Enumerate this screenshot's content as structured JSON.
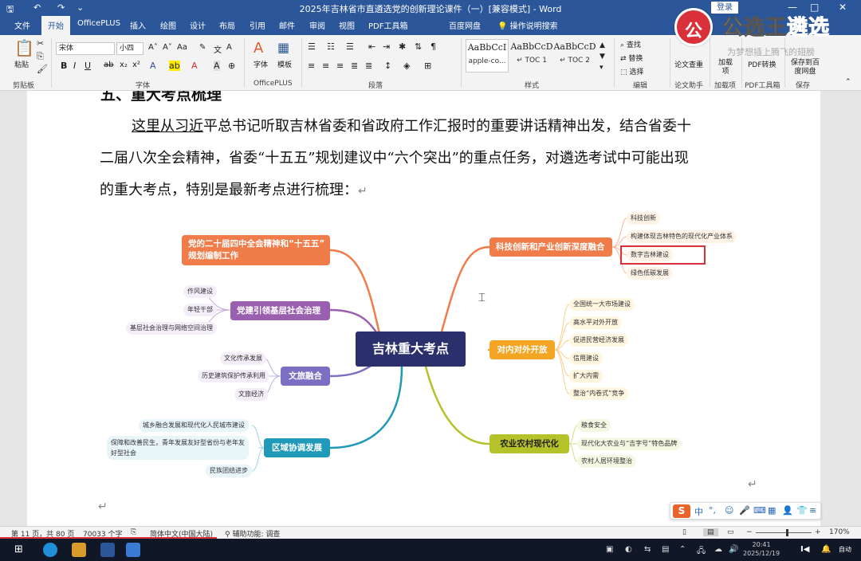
{
  "window": {
    "title": "2025年吉林省市直遴选党的创新理论课件（一）[兼容模式] - Word",
    "login_label": "登录",
    "minimize": "—",
    "maximize": "□",
    "close": "✕"
  },
  "brand": {
    "name_main": "公选王",
    "name_accent": "遴选",
    "slogan": "为梦想插上腾飞的翅膀"
  },
  "menu": {
    "items": [
      "文件",
      "开始",
      "OfficePLUS",
      "插入",
      "绘图",
      "设计",
      "布局",
      "引用",
      "邮件",
      "审阅",
      "视图",
      "PDF工具箱",
      "百度网盘"
    ],
    "active": "开始",
    "tell_me": "操作说明搜索"
  },
  "ribbon": {
    "clipboard": {
      "paste": "粘贴",
      "label": "剪贴板"
    },
    "font": {
      "name": "宋体",
      "size": "小四",
      "label": "字体"
    },
    "officeplus": {
      "font": "字体",
      "template": "模板",
      "label": "OfficePLUS"
    },
    "paragraph": {
      "label": "段落"
    },
    "styles": {
      "items": [
        {
          "preview": "AaBbCcI",
          "name": "apple-co..."
        },
        {
          "preview": "AaBbCcD",
          "name": "↵ TOC 1"
        },
        {
          "preview": "AaBbCcD",
          "name": "↵ TOC 2"
        }
      ],
      "label": "样式"
    },
    "editing": {
      "find": "查找",
      "replace": "替换",
      "select": "选择",
      "label": "编辑"
    },
    "paper_check": {
      "button": "论文查重",
      "label": "论文助手"
    },
    "addins": {
      "button": "加载项",
      "label": "加载项"
    },
    "pdf": {
      "button": "PDF转换",
      "label": "PDF工具箱"
    },
    "save": {
      "button": "保存到百度网盘",
      "label": "保存"
    }
  },
  "document": {
    "heading_partial": "五、重大考点梳理",
    "para_line1_underlined": "这里从习近",
    "para_line1_rest": "平总书记听取吉林省委和省政府工作汇报时的重要讲话精神出发，结合省委十",
    "para_line2": "二届八次全会精神，省委“十五五”规划建议中“六个突出”的重点任务，对遴选考试中可能出现",
    "para_line3": "的重大考点，特别是最新考点进行梳理：",
    "return_mark": "↵"
  },
  "mindmap": {
    "center": "吉林重大考点",
    "branches": [
      {
        "label": "党的二十届四中全会精神和“十五五”规划编制工作",
        "line1": "党的二十届四中全会精神和“十五五”",
        "line2": "规划编制工作",
        "color": "#f07c4a",
        "leaves": []
      },
      {
        "label": "党建引领基层社会治理",
        "color": "#9b5fb0",
        "leaves": [
          "作风建设",
          "年轻干部",
          "基层社会治理与网络空间治理"
        ]
      },
      {
        "label": "文旅融合",
        "color": "#7b6fc4",
        "leaves": [
          "文化传承发展",
          "历史建筑保护传承利用",
          "文旅经济"
        ]
      },
      {
        "label": "区域协调发展",
        "color": "#1f9ab8",
        "leaves": [
          "城乡融合发展和现代化人民城市建设",
          "保障和改善民生，青年发展友好型省份与老年友好型社会",
          "民族团结进步"
        ],
        "leaf2_line1": "保障和改善民生，青年发展友好型省份与老年友",
        "leaf2_line2": "好型社会"
      },
      {
        "label": "科技创新和产业创新深度融合",
        "color": "#f07c4a",
        "leaves": [
          "科技创新",
          "构建体现吉林特色的现代化产业体系",
          "数字吉林建设",
          "绿色低碳发展"
        ],
        "highlighted": "数字吉林建设"
      },
      {
        "label": "对内对外开放",
        "color": "#f5a524",
        "leaves": [
          "全国统一大市场建设",
          "高水平对外开放",
          "促进民营经济发展",
          "信用建设",
          "扩大内需",
          "整治“内卷式”竞争"
        ]
      },
      {
        "label": "农业农村现代化",
        "color": "#b5c22a",
        "leaves": [
          "粮食安全",
          "现代化大农业与“吉字号”特色品牌",
          "农村人居环境整治"
        ]
      }
    ]
  },
  "statusbar": {
    "page": "第 11 页，共 80 页",
    "words": "70033 个字",
    "language": "简体中文(中国大陆)",
    "accessibility": "辅助功能: 调查",
    "zoom": "170%",
    "zoom_level": 0.55
  },
  "ime": {
    "logo": "S",
    "mode": "中"
  },
  "taskbar": {
    "time": "20:41",
    "date": "2025/12/19",
    "input_mode": "自动"
  },
  "colors": {
    "word_blue": "#2b579a",
    "center_node": "#2b2f6b",
    "highlight_red": "#d9303a"
  }
}
